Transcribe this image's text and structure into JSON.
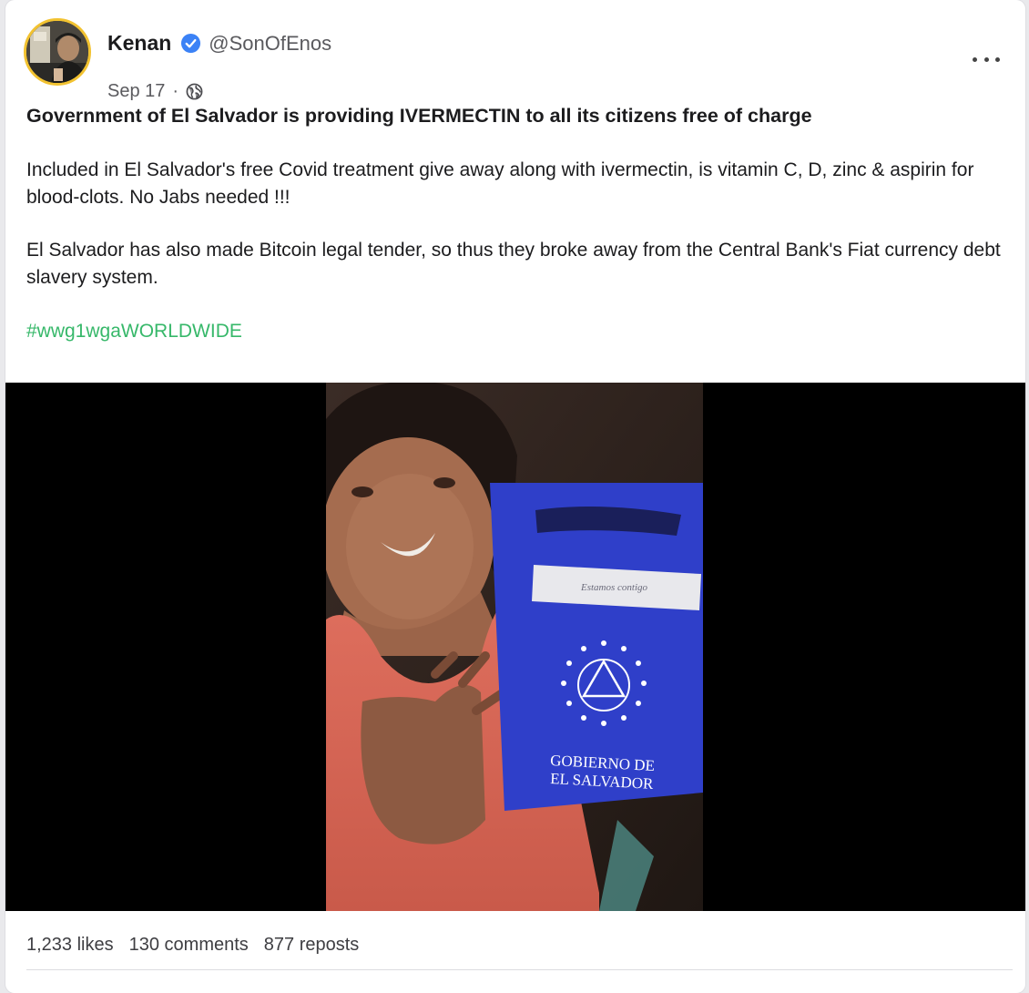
{
  "post": {
    "author": {
      "name": "Kenan",
      "handle": "@SonOfEnos",
      "verified": true
    },
    "date": "Sep 17",
    "separator": "·",
    "visibility_icon": "globe-icon",
    "title": "Government of El Salvador is providing IVERMECTIN to all its citizens free of charge",
    "paragraph1": "Included in El Salvador's free Covid treatment give away along with ivermectin, is vitamin C, D, zinc & aspirin for blood-clots. No Jabs needed !!!",
    "paragraph2": "El Salvador has also made Bitcoin legal tender, so thus they broke away from the Central Bank's Fiat currency debt slavery system.",
    "hashtag": "#wwg1wgaWORLDWIDE",
    "media": {
      "bag_label_line1": "GOBIERNO DE",
      "bag_label_line2": "EL SALVADOR",
      "bag_tag_line1": "Estamos contigo"
    },
    "stats": {
      "likes": "1,233 likes",
      "comments": "130 comments",
      "reposts": "877 reposts"
    }
  },
  "colors": {
    "hashtag": "#37b86a",
    "verified": "#3b82f6",
    "avatar_ring": "#f2c230",
    "bag_blue": "#2f3fc9"
  }
}
